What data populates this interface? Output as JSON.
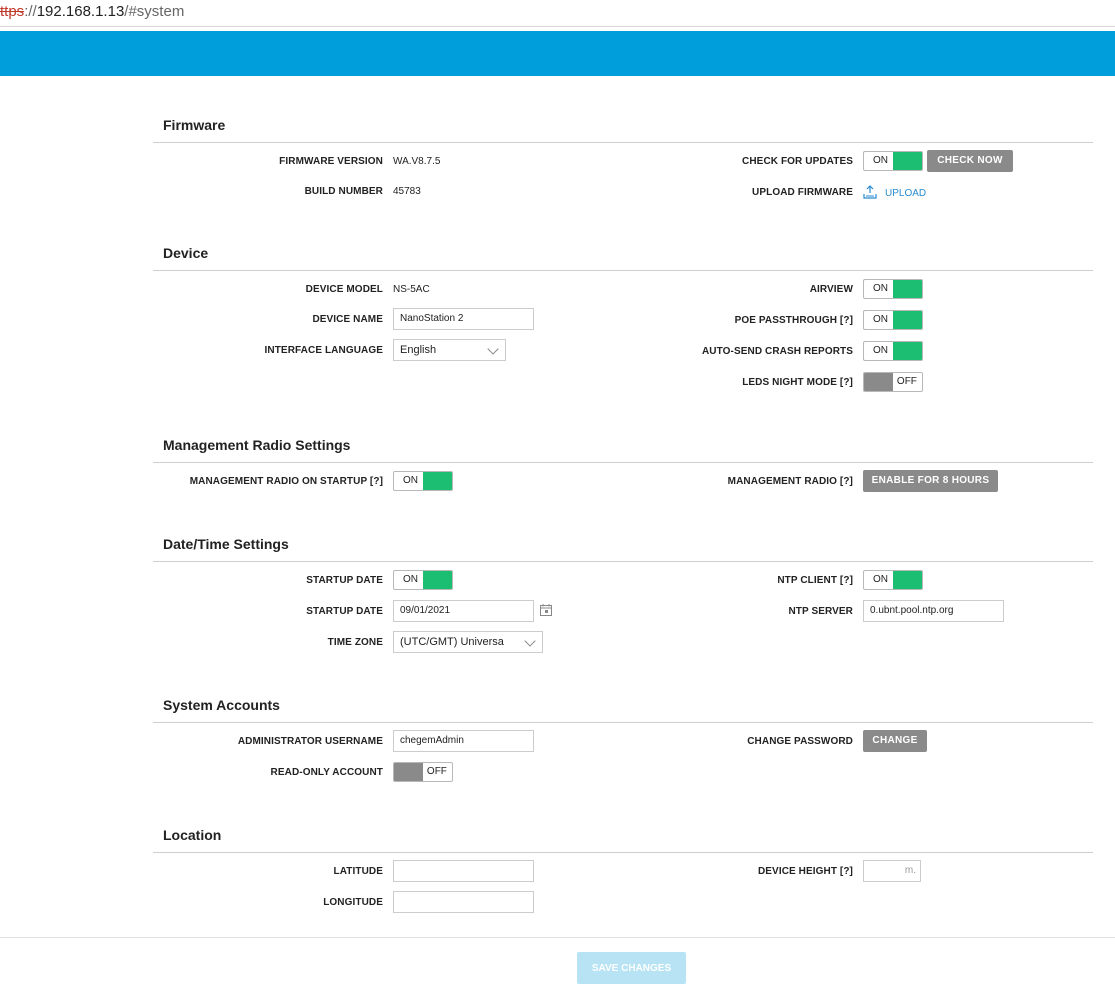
{
  "browser": {
    "scheme": "ttps",
    "separator": "://",
    "host": "192.168.1.13",
    "path": "/#system"
  },
  "firmware": {
    "title": "Firmware",
    "firmware_version_label": "FIRMWARE VERSION",
    "firmware_version_value": "WA.V8.7.5",
    "build_number_label": "BUILD NUMBER",
    "build_number_value": "45783",
    "check_updates_label": "CHECK FOR UPDATES",
    "check_updates_state": "ON",
    "check_now_label": "CHECK NOW",
    "upload_firmware_label": "UPLOAD FIRMWARE",
    "upload_link": "UPLOAD"
  },
  "device": {
    "title": "Device",
    "model_label": "DEVICE MODEL",
    "model_value": "NS-5AC",
    "name_label": "DEVICE NAME",
    "name_value": "NanoStation 2",
    "language_label": "INTERFACE LANGUAGE",
    "language_value": "English",
    "airview_label": "AIRVIEW",
    "airview_state": "ON",
    "poe_label": "POE PASSTHROUGH [?]",
    "poe_state": "ON",
    "crash_label": "AUTO-SEND CRASH REPORTS",
    "crash_state": "ON",
    "leds_label": "LEDS NIGHT MODE [?]",
    "leds_state": "OFF"
  },
  "management": {
    "title": "Management Radio Settings",
    "startup_label": "MANAGEMENT RADIO ON STARTUP [?]",
    "startup_state": "ON",
    "radio_label": "MANAGEMENT RADIO [?]",
    "radio_button": "ENABLE FOR 8 HOURS"
  },
  "datetime": {
    "title": "Date/Time Settings",
    "startup_date_toggle_label": "STARTUP DATE",
    "startup_date_state": "ON",
    "startup_date_label": "STARTUP DATE",
    "startup_date_value": "09/01/2021",
    "timezone_label": "TIME ZONE",
    "timezone_value": "(UTC/GMT) Universa",
    "ntp_client_label": "NTP CLIENT [?]",
    "ntp_client_state": "ON",
    "ntp_server_label": "NTP SERVER",
    "ntp_server_value": "0.ubnt.pool.ntp.org"
  },
  "accounts": {
    "title": "System Accounts",
    "admin_label": "ADMINISTRATOR USERNAME",
    "admin_value": "chegemAdmin",
    "readonly_label": "READ-ONLY ACCOUNT",
    "readonly_state": "OFF",
    "change_password_label": "CHANGE PASSWORD",
    "change_button": "CHANGE"
  },
  "location": {
    "title": "Location",
    "latitude_label": "LATITUDE",
    "latitude_value": "",
    "longitude_label": "LONGITUDE",
    "longitude_value": "",
    "height_label": "DEVICE HEIGHT [?]",
    "height_unit": "m."
  },
  "footer": {
    "save_label": "SAVE CHANGES"
  },
  "colors": {
    "header_blue": "#009edb",
    "toggle_on_green": "#1cbf71",
    "toggle_off_grey": "#8a8a8a",
    "link_blue": "#2a8bd0"
  }
}
